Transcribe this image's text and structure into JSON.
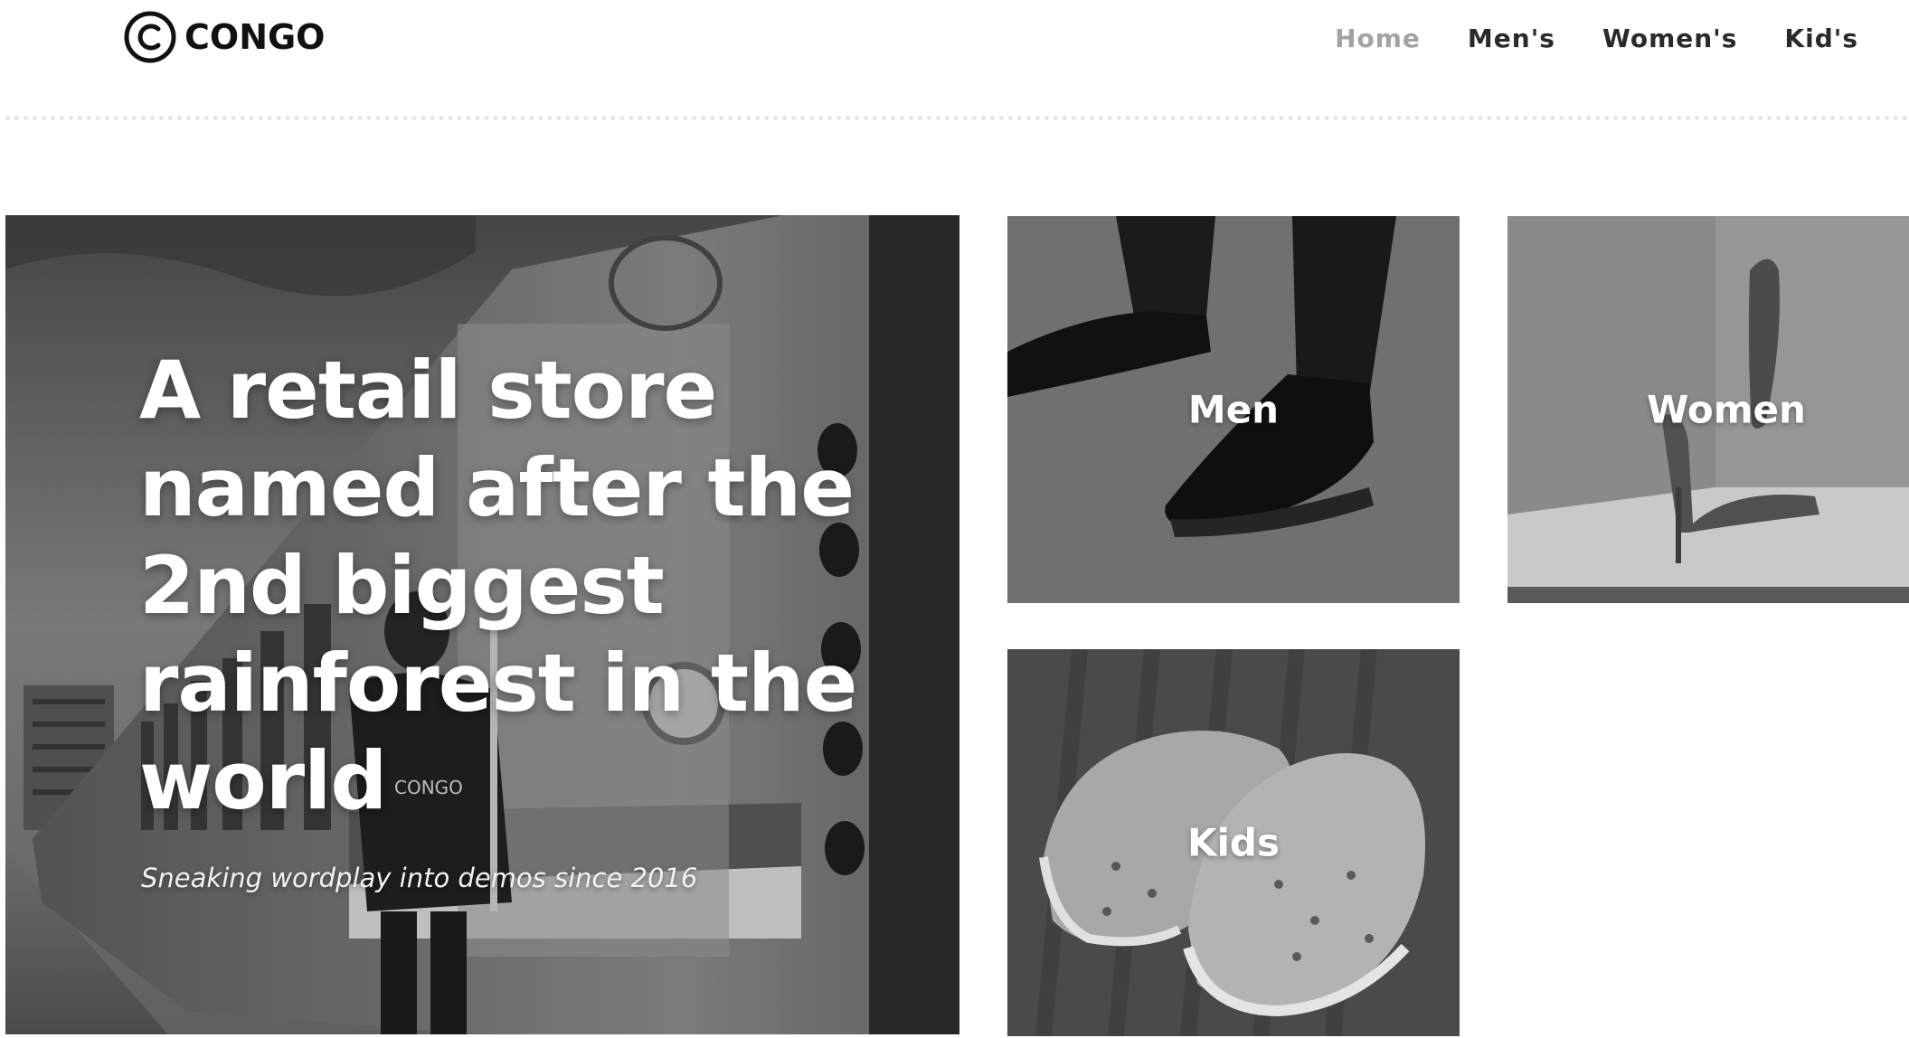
{
  "brand": {
    "name": "CONGO",
    "logo_icon": "copyright-circle-icon"
  },
  "nav": {
    "items": [
      {
        "label": "Home",
        "active": true
      },
      {
        "label": "Men's",
        "active": false
      },
      {
        "label": "Women's",
        "active": false
      },
      {
        "label": "Kid's",
        "active": false
      }
    ]
  },
  "hero": {
    "title": "A retail store named after the 2nd biggest rainforest in the world",
    "subtitle": "Sneaking wordplay into demos since 2016",
    "shirt_print": "CONGO"
  },
  "categories": {
    "men": {
      "label": "Men"
    },
    "women": {
      "label": "Women"
    },
    "kids": {
      "label": "Kids"
    }
  },
  "colors": {
    "nav_active": "#a3a3a3",
    "nav_default": "#2a2a2a",
    "overlay_text": "#ffffff"
  }
}
